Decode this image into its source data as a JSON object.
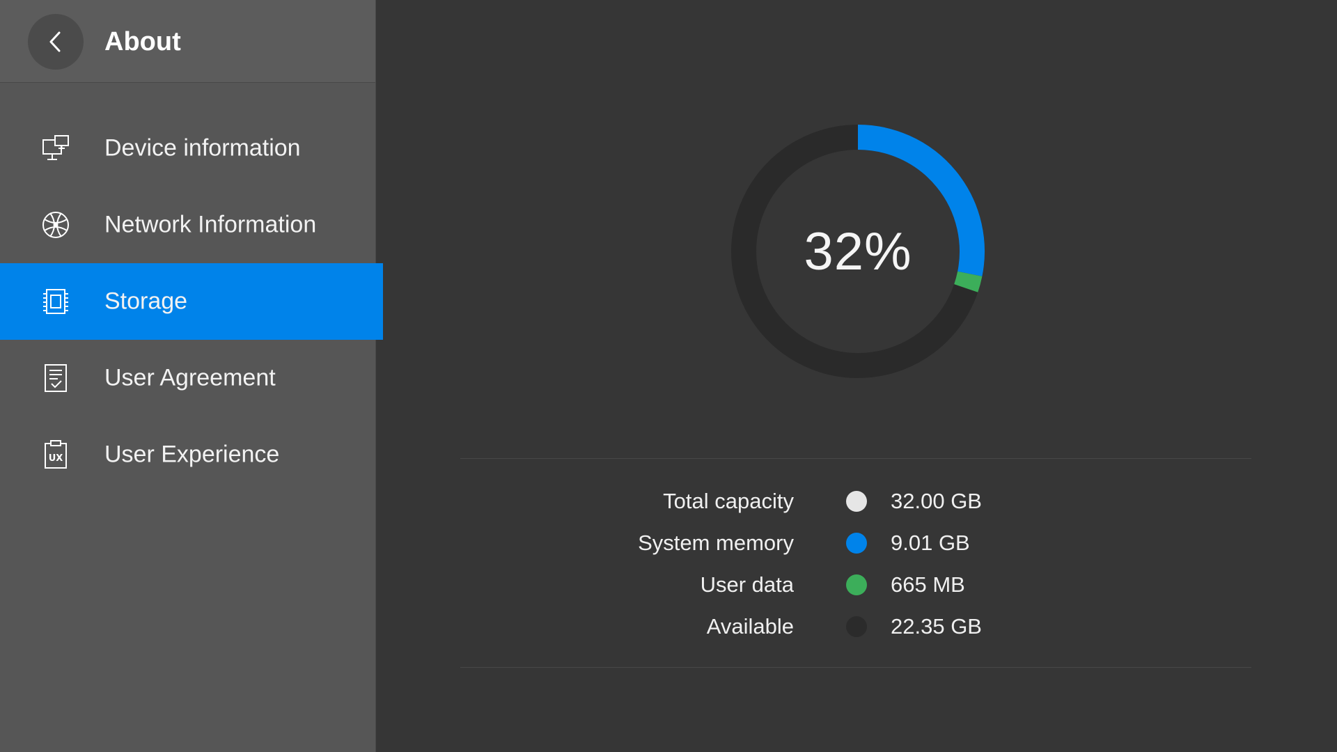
{
  "header": {
    "title": "About"
  },
  "sidebar": {
    "items": [
      {
        "label": "Device information",
        "icon": "device-icon"
      },
      {
        "label": "Network Information",
        "icon": "globe-icon"
      },
      {
        "label": "Storage",
        "icon": "chip-icon",
        "active": true
      },
      {
        "label": "User Agreement",
        "icon": "document-check-icon"
      },
      {
        "label": "User Experience",
        "icon": "clipboard-ux-icon"
      }
    ],
    "ux_glyph": "UX"
  },
  "storage": {
    "percent_label": "32%",
    "percent_used": 32,
    "legend": [
      {
        "label": "Total capacity",
        "value": "32.00 GB",
        "color": "#e6e6e6"
      },
      {
        "label": "System memory",
        "value": "9.01 GB",
        "color": "#0083ea"
      },
      {
        "label": "User data",
        "value": "665 MB",
        "color": "#3cae5a"
      },
      {
        "label": "Available",
        "value": "22.35 GB",
        "color": "#2b2b2b"
      }
    ]
  },
  "colors": {
    "accent": "#0083ea",
    "system": "#0083ea",
    "user_data": "#3cae5a",
    "track": "#2a2a2a",
    "background": "#363636",
    "sidebar": "#565656"
  }
}
